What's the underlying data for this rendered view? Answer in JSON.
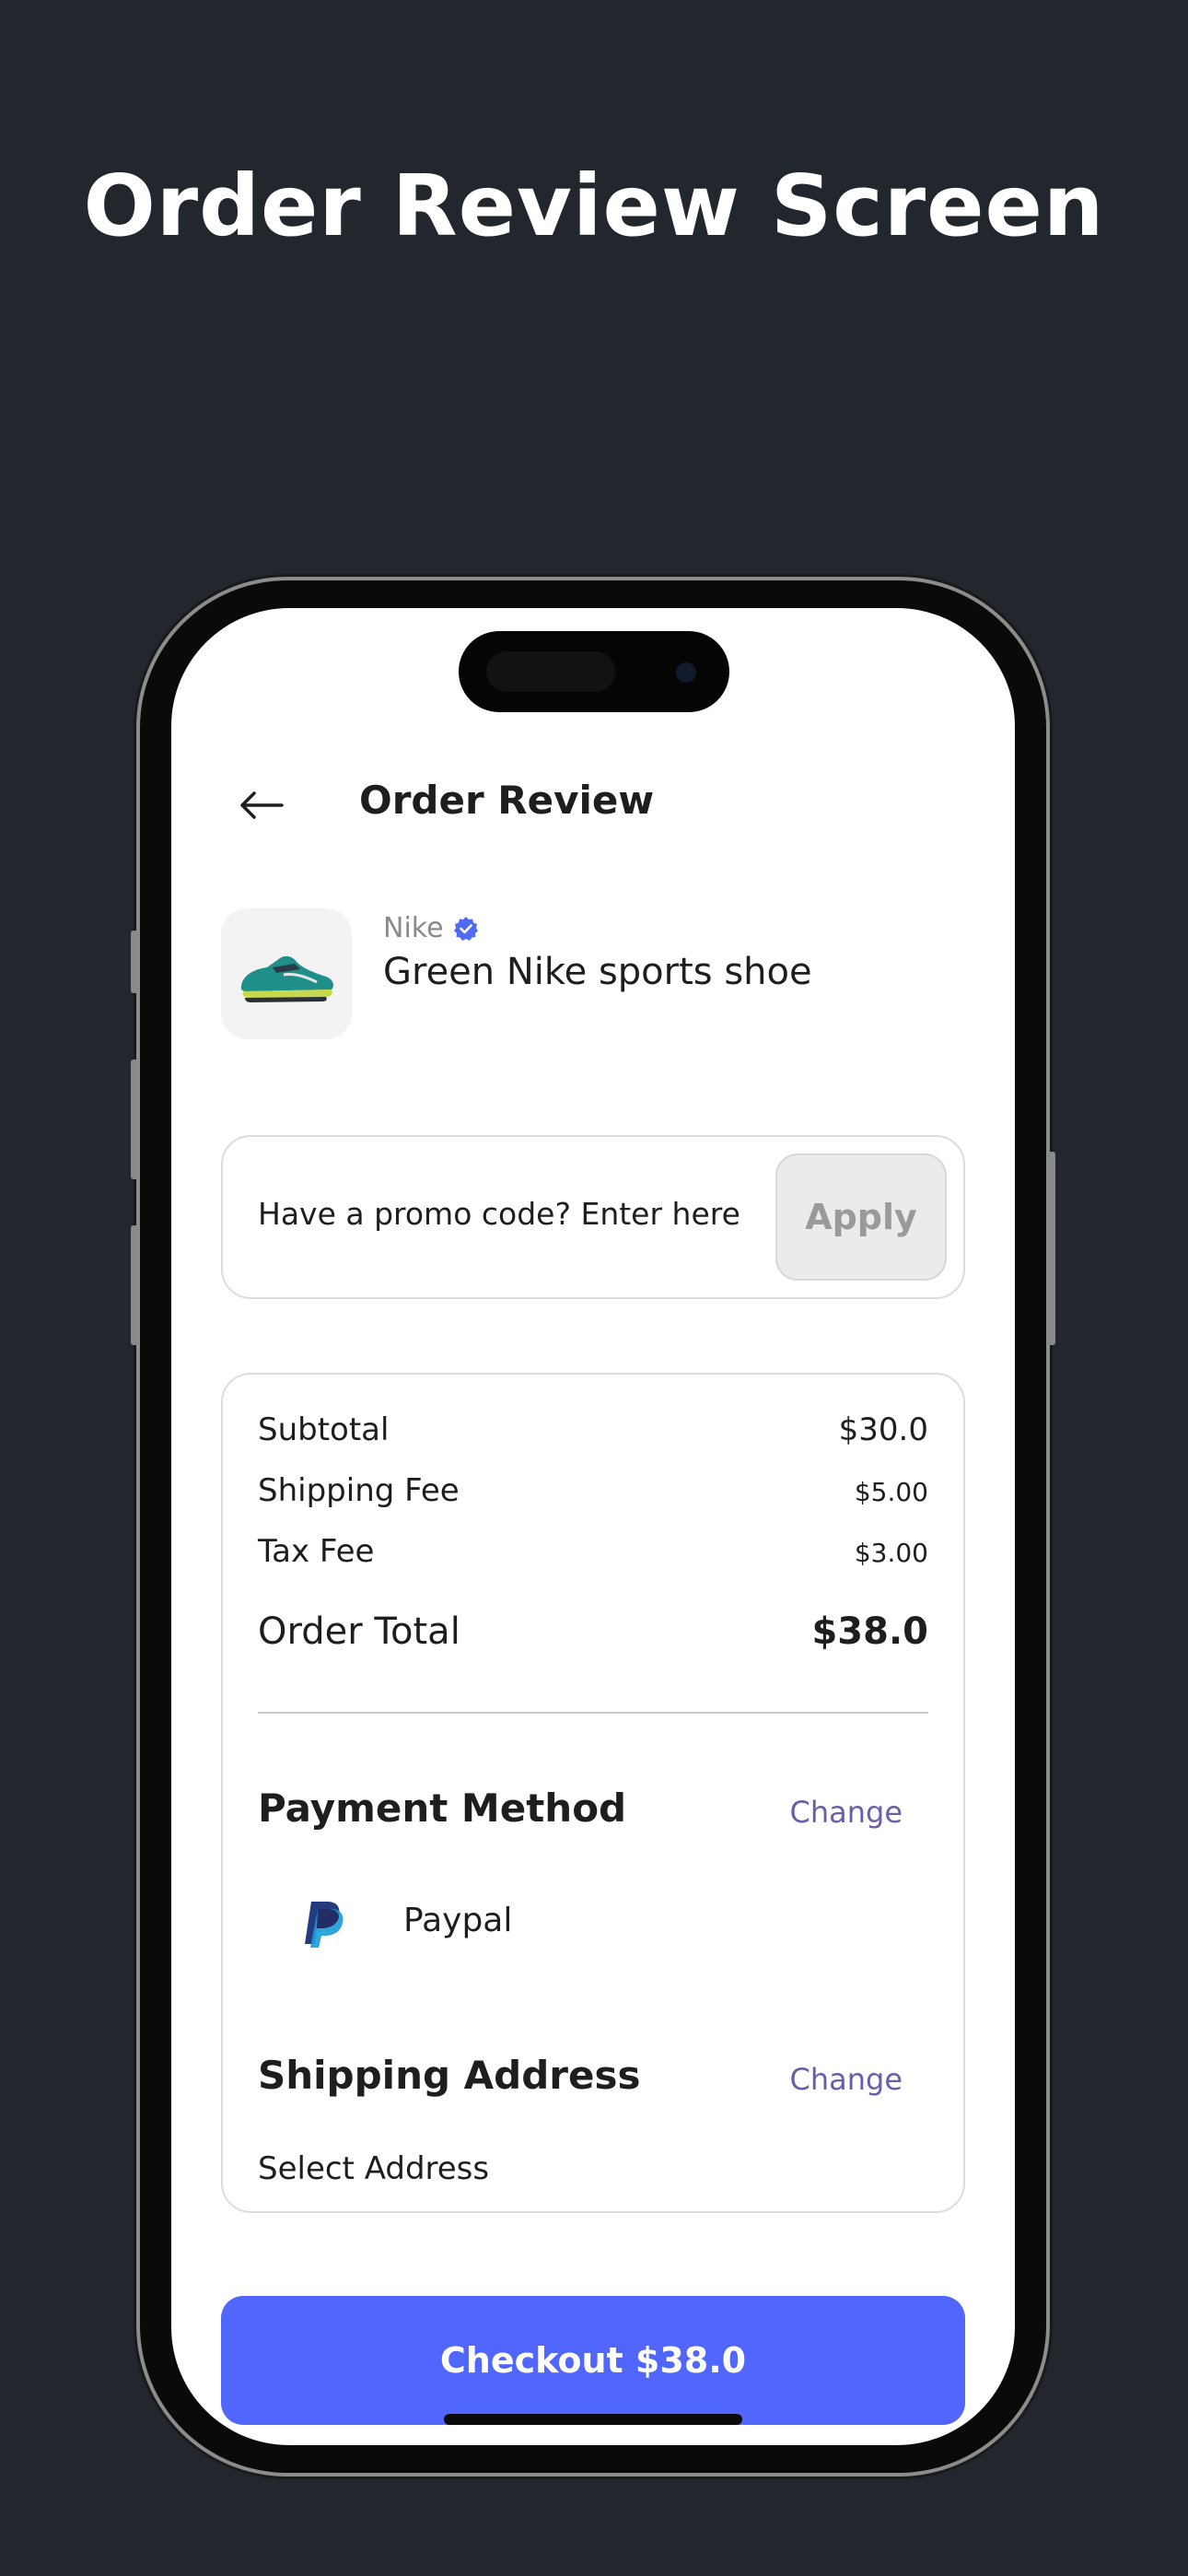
{
  "hero": {
    "title": "Order Review Screen"
  },
  "header": {
    "title": "Order Review"
  },
  "product": {
    "brand": "Nike",
    "name": "Green Nike sports shoe",
    "verified_icon": "verified-badge-icon",
    "brand_color": "#4f6af5"
  },
  "promo": {
    "placeholder": "Have a promo code? Enter here",
    "apply_label": "Apply"
  },
  "summary": {
    "subtotal_label": "Subtotal",
    "subtotal_value": "$30.0",
    "shipping_label": "Shipping Fee",
    "shipping_value": "$5.00",
    "tax_label": "Tax Fee",
    "tax_value": "$3.00",
    "total_label": "Order Total",
    "total_value": "$38.0"
  },
  "payment": {
    "title": "Payment Method",
    "change_label": "Change",
    "method_label": "Paypal",
    "method_icon": "paypal-icon"
  },
  "shipping": {
    "title": "Shipping Address",
    "change_label": "Change",
    "address_text": "Select Address"
  },
  "checkout": {
    "label": "Checkout $38.0"
  },
  "colors": {
    "background": "#22262d",
    "accent": "#5066fd",
    "link": "#6b5ea8"
  }
}
